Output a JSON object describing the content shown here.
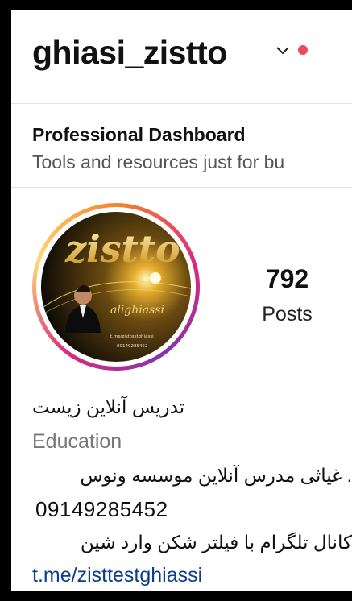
{
  "header": {
    "username": "ghiasi_zistto",
    "dropdown_icon": "chevron-down-icon",
    "notification_dot_color": "#ed4956"
  },
  "dashboard": {
    "title": "Professional Dashboard",
    "subtitle": "Tools and resources just for bu"
  },
  "profile": {
    "avatar_logo_text": "zistto",
    "avatar_name_text": "alighiassi",
    "avatar_link_text": "t.me/zisttestghiassi",
    "avatar_phone_text": "09149285452",
    "story_ring_colors": [
      "#f58529",
      "#dd2a7b",
      "#8134af",
      "#feda77"
    ]
  },
  "stats": {
    "posts_count": "792",
    "posts_label": "Posts"
  },
  "bio": {
    "name": "تدریس آنلاین زیست",
    "category": "Education",
    "line1": ". غیاثی مدرس آنلاین موسسه ونوس",
    "phone": "09149285452",
    "line2": "کانال تلگرام با فیلتر شکن وارد شین",
    "link": "t.me/zisttestghiassi"
  }
}
